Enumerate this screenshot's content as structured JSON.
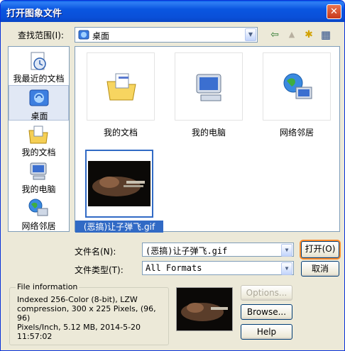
{
  "window": {
    "title": "打开图象文件",
    "close_glyph": "✕"
  },
  "toolbar": {
    "look_in_label": "查找范围(I):",
    "look_in_value": "桌面",
    "back_glyph": "⇦",
    "up_glyph": "▲",
    "new_folder_glyph": "✱",
    "view_glyph": "▦"
  },
  "places": [
    {
      "label": "我最近的文档",
      "icon": "recent-documents-icon"
    },
    {
      "label": "桌面",
      "icon": "desktop-icon"
    },
    {
      "label": "我的文档",
      "icon": "my-documents-icon"
    },
    {
      "label": "我的电脑",
      "icon": "my-computer-icon"
    },
    {
      "label": "网络邻居",
      "icon": "network-places-icon"
    }
  ],
  "files": [
    {
      "label": "我的文档",
      "icon": "folder-documents-icon"
    },
    {
      "label": "我的电脑",
      "icon": "computer-icon"
    },
    {
      "label": "网络邻居",
      "icon": "network-icon"
    },
    {
      "label": "(恶搞)让子弹飞.gif",
      "icon": "gif-thumbnail"
    }
  ],
  "form": {
    "filename_label": "文件名(N):",
    "filename_value": "(恶搞)让子弹飞.gif",
    "filetype_label": "文件类型(T):",
    "filetype_value": "All Formats",
    "open_button": "打开(O)",
    "cancel_button": "取消"
  },
  "file_info": {
    "legend": "File information",
    "text": "Indexed 256-Color (8-bit), LZW\ncompression, 300 x 225 Pixels, (96, 96)\nPixels/Inch, 5.12 MB, 2014-5-20\n11:57:02"
  },
  "buttons": {
    "options": "Options...",
    "browse": "Browse...",
    "help": "Help"
  }
}
